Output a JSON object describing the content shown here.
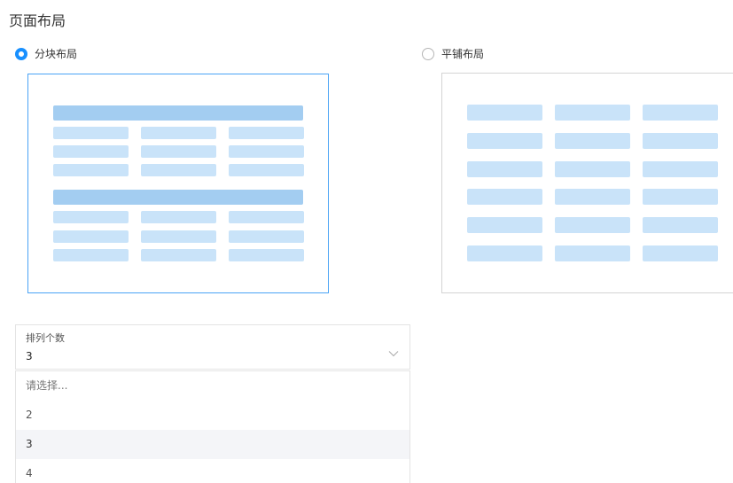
{
  "title": "页面布局",
  "layout_options": {
    "block": {
      "label": "分块布局",
      "selected": true
    },
    "tile": {
      "label": "平铺布局",
      "selected": false
    }
  },
  "columns_select": {
    "label": "排列个数",
    "value": "3",
    "options": [
      {
        "label": "请选择...",
        "placeholder": true
      },
      {
        "label": "2"
      },
      {
        "label": "3",
        "highlighted": true
      },
      {
        "label": "4"
      }
    ]
  },
  "colors": {
    "accent": "#1890ff",
    "preview_header": "#a3cdf1",
    "preview_cell": "#c9e3f9"
  },
  "icons": [
    "radio-checked-icon",
    "radio-unchecked-icon",
    "chevron-down-icon"
  ]
}
